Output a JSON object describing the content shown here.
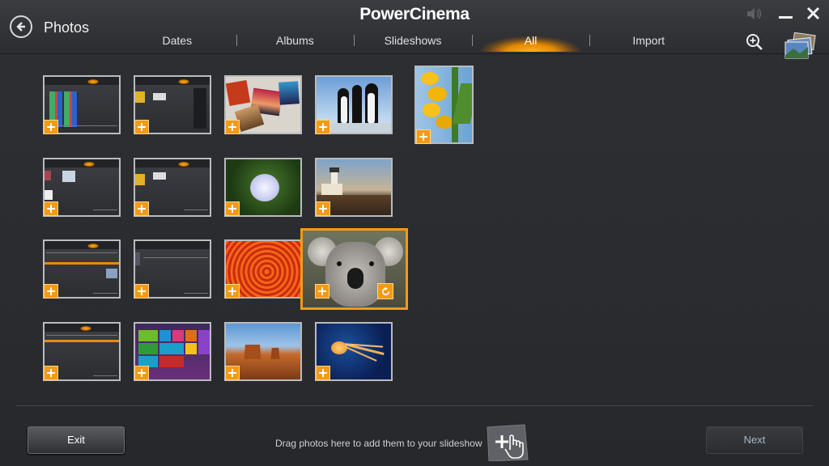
{
  "header": {
    "app_title": "PowerCinema",
    "page_title": "Photos"
  },
  "tabs": [
    {
      "label": "Dates",
      "active": false
    },
    {
      "label": "Albums",
      "active": false
    },
    {
      "label": "Slideshows",
      "active": false
    },
    {
      "label": "All",
      "active": true
    },
    {
      "label": "Import",
      "active": false
    }
  ],
  "window_controls": [
    "volume-icon",
    "minimize-icon",
    "close-icon"
  ],
  "toolbar_icons": [
    "zoom-in-icon",
    "slideshow-stack-icon"
  ],
  "photos": [
    {
      "name": "screenshot-photos-grid"
    },
    {
      "name": "screenshot-import"
    },
    {
      "name": "photo-collage"
    },
    {
      "name": "penguins"
    },
    {
      "name": "tulips"
    },
    {
      "name": "screenshot-albums"
    },
    {
      "name": "screenshot-device"
    },
    {
      "name": "hydrangea"
    },
    {
      "name": "lighthouse"
    },
    {
      "name": "screenshot-list"
    },
    {
      "name": "screenshot-folder"
    },
    {
      "name": "chrysanthemum"
    },
    {
      "name": "koala",
      "selected": true
    },
    {
      "name": "screenshot-settings"
    },
    {
      "name": "screenshot-start-screen"
    },
    {
      "name": "desert"
    },
    {
      "name": "jellyfish"
    }
  ],
  "footer": {
    "exit_label": "Exit",
    "next_label": "Next",
    "drag_hint": "Drag photos here to add them to your slideshow"
  },
  "colors": {
    "accent": "#f39a14",
    "background": "#2b2d31",
    "next_text": "#a9b4c2"
  }
}
